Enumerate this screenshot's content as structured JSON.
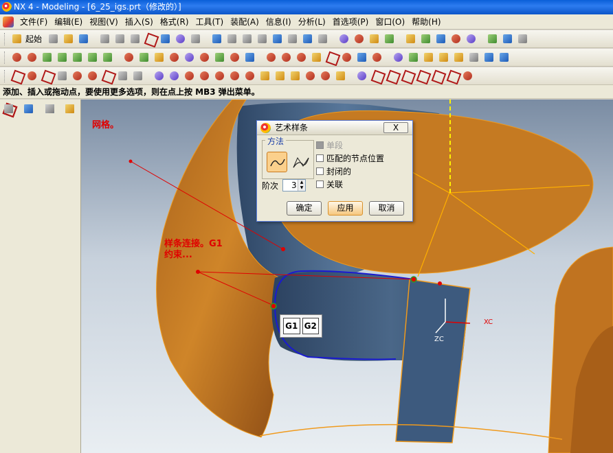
{
  "window": {
    "title": "NX 4 - Modeling - [6_25_igs.prt（修改的）]"
  },
  "menu": [
    {
      "label": "文件(F)"
    },
    {
      "label": "编辑(E)"
    },
    {
      "label": "视图(V)"
    },
    {
      "label": "插入(S)"
    },
    {
      "label": "格式(R)"
    },
    {
      "label": "工具(T)"
    },
    {
      "label": "装配(A)"
    },
    {
      "label": "信息(I)"
    },
    {
      "label": "分析(L)"
    },
    {
      "label": "首选项(P)"
    },
    {
      "label": "窗口(O)"
    },
    {
      "label": "帮助(H)"
    }
  ],
  "toolbar": {
    "start_label": "起始"
  },
  "status": {
    "prompt": "添加、插入或拖动点，要使用更多选项，则在点上按 MB3 弹出菜单。"
  },
  "annotations": {
    "mesh": "网格。",
    "spline_line1": "样条连接。G1",
    "spline_line2": "约束..."
  },
  "continuity": {
    "g1": "G1",
    "g2": "G2"
  },
  "axes": {
    "xc": "XC",
    "zc": "ZC"
  },
  "dialog": {
    "title": "艺术样条",
    "close_label": "X",
    "method_legend": "方法",
    "single_segment": "单段",
    "match_knots": "匹配的节点位置",
    "closed": "封闭的",
    "associative": "关联",
    "degree_label": "阶次",
    "degree_value": "3",
    "ok": "确定",
    "apply": "应用",
    "cancel": "取消"
  },
  "colors": {
    "surface_orange": "#c87a1e",
    "surface_blue": "#3c5a7d",
    "spline_blue": "#1a1ad0",
    "annotation_red": "#e00000"
  }
}
